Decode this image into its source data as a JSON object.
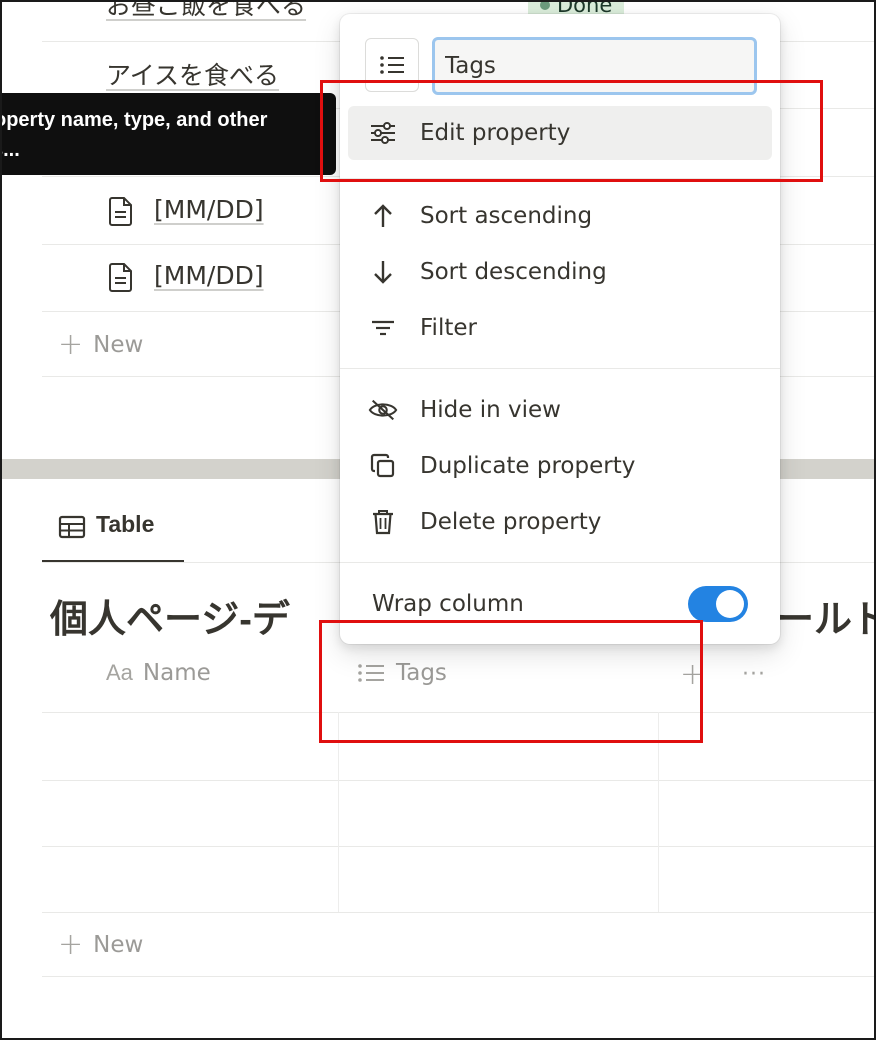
{
  "top_table": {
    "rows": [
      {
        "name": "お昼ご飯を食べる",
        "status": "Done"
      },
      {
        "name": "アイスを食べる"
      },
      {
        "name": "[MM/DD]"
      },
      {
        "name": "[MM/DD]"
      }
    ],
    "new_label": "New"
  },
  "tooltip": {
    "line1": "operty name, type, and other",
    "line2": "s..."
  },
  "lower_table": {
    "view_tab": "Table",
    "title_left": "個人ページ-デ",
    "title_right": "ールド",
    "columns": {
      "name_prefix": "Aa",
      "name_label": "Name",
      "tags_label": "Tags"
    },
    "add_column": "+",
    "more": "···",
    "new_label": "New"
  },
  "menu": {
    "property_name_value": "Tags",
    "items": {
      "edit": "Edit property",
      "sort_asc": "Sort ascending",
      "sort_desc": "Sort descending",
      "filter": "Filter",
      "hide": "Hide in view",
      "duplicate": "Duplicate property",
      "delete": "Delete property",
      "wrap": "Wrap column"
    },
    "wrap_enabled": true
  },
  "colors": {
    "accent": "#2383e2",
    "highlight": "#e00f0f",
    "status_done_bg": "#dbeddb"
  }
}
